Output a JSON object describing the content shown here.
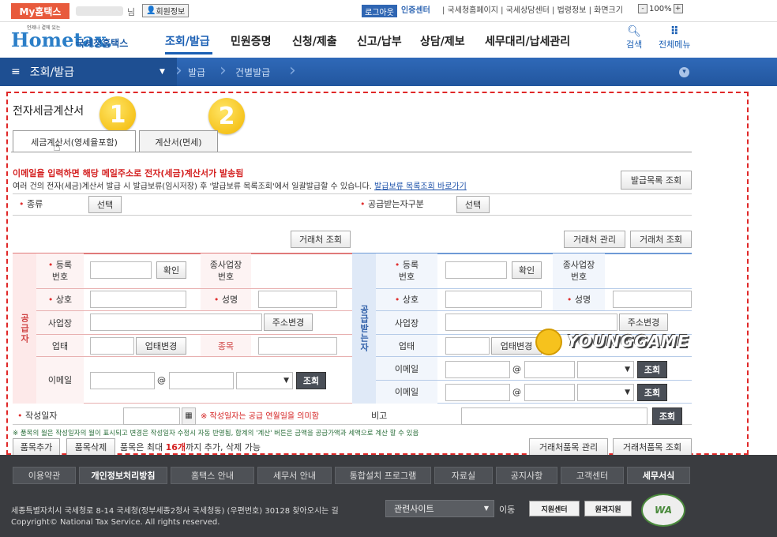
{
  "topbar": {
    "mytax": "My홈택스",
    "nim": "님",
    "member_info": "회원정보",
    "logout": "로그아웃",
    "auth_center": "인증센터",
    "links": "| 국세청홈페이지 | 국세상담센터 | 법령정보 | 화면크기",
    "zoom": "100%",
    "zoom_minus": "-",
    "zoom_plus": "+"
  },
  "header": {
    "logo_main": "Hometax.",
    "logo_sub": "국세청홈택스",
    "logo_tiny": "언제나 곁에 있는",
    "nav": [
      "조회/발급",
      "민원증명",
      "신청/제출",
      "신고/납부",
      "상담/제보",
      "세무대리/납세관리"
    ],
    "search": "검색",
    "all_menu": "전체메뉴"
  },
  "breadcrumb": {
    "level1": "조회/발급",
    "level2": "발급",
    "level3": "건별발급"
  },
  "main": {
    "title": "전자세금계산서",
    "badges": [
      "1",
      "2"
    ],
    "tabs": [
      "세금계산서(영세율포함)",
      "계산서(면세)"
    ],
    "notice_red": "이메일을 입력하면 해당 메일주소로 전자(세금)계산서가 발송됨",
    "notice": "여러 건의 전자(세금)계산서 발급 시 발급보류(임시저장) 후 '발급보류 목록조회'에서 일괄발급할 수 있습니다.",
    "notice_link": "발급보류 목록조회 바로가기",
    "issue_list_btn": "발급목록 조회",
    "kind_label": "종류",
    "select_btn": "선택",
    "recv_type_label": "공급받는자구분",
    "partner_lookup": "거래처 조회",
    "partner_manage": "거래처 관리",
    "supplier_head": "공급자",
    "receiver_head": "공급받는자",
    "reg_no": "등록\n번호",
    "confirm": "확인",
    "sub_biz": "종사업장\n번호",
    "company": "상호",
    "name": "성명",
    "address": "사업장",
    "change_addr": "주소변경",
    "biz_type": "업태",
    "change_biz": "업태변경",
    "item": "종목",
    "email": "이메일",
    "at": "@",
    "lookup": "조회",
    "write_date": "작성일자",
    "date_note": "※ 작성일자는 공급 연월일을 의미함",
    "remark": "비고",
    "items_note": "※ 품목의 월은 작성일자의 월이 표시되고 변경은 작성일자 수정시 자동 반영됨, 합계의 '계산' 버튼은 금액을 공급가액과 세액으로 계산 할 수 있음",
    "add_item": "품목추가",
    "del_item": "품목삭제",
    "items_limit_pre": "품목은 최대",
    "items_limit_num": "16개",
    "items_limit_post": "까지 추가, 삭제 가능",
    "partner_item_manage": "거래처품목 관리",
    "partner_item_lookup": "거래처품목 조회",
    "watermark": "YOUNGGAME"
  },
  "footer": {
    "links": [
      "이용약관",
      "개인정보처리방침",
      "홈택스 안내",
      "세무서 안내",
      "통합설치 프로그램",
      "자료실",
      "공지사항",
      "고객센터",
      "세무서식"
    ],
    "address": "세종특별자치시 국세청로 8-14 국세청(정부세종2청사 국세청동) (우편번호) 30128",
    "directions": "찾아오시는 길",
    "copyright": "Copyright© National Tax Service. All rights reserved.",
    "related": "관련사이트",
    "go": "이동",
    "btn1": "지원센터",
    "btn2": "원격지원",
    "wa": "WA"
  },
  "colors": {
    "accent": "#1a5fb4",
    "supplier": "#e07a7a",
    "receiver": "#6e9ad6",
    "frame": "#e02828",
    "badge": "#f2b600"
  }
}
